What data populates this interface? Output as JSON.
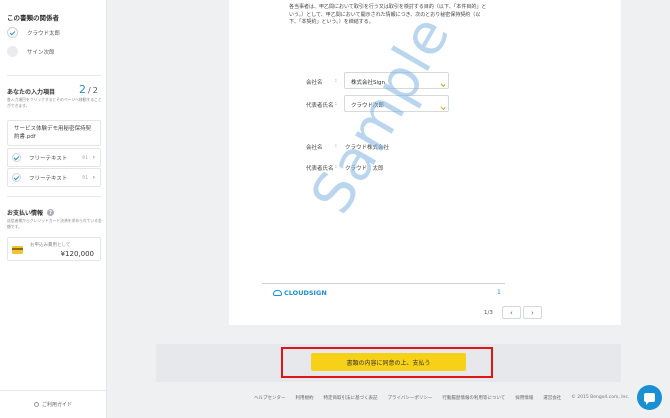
{
  "sidebar": {
    "parties_title": "この書類の関係者",
    "parties": [
      {
        "name": "クラウド太郎",
        "done": true
      },
      {
        "name": "サイン次郎",
        "done": false
      }
    ],
    "inputs_title": "あなたの入力項目",
    "inputs_done": "2",
    "inputs_total": "2",
    "inputs_desc": "各入力項目をクリックするとそのページへ移動することができます。",
    "doc_name": "サービス体験デモ用秘密保持契約書.pdf",
    "fields": [
      {
        "label": "フリーテキスト",
        "page": "P.1"
      },
      {
        "label": "フリーテキスト",
        "page": "P.1"
      }
    ],
    "payment_title": "お支払い情報",
    "payment_desc": "送信者様からクレジットカード決済を求められている金額です。",
    "payment_label": "お申込み費用として",
    "payment_amount": "¥120,000",
    "help_label": "ご利用ガイド"
  },
  "document": {
    "paragraph": "各当事者は、甲乙間において取引を行う又は取引を検討する目的（以下、「本件目的」という。）として、甲乙間において開示された情報につき、次のとおり秘密保持契約（以下、「本契約」という。）を締結する。",
    "party1": {
      "company_label": "会社名",
      "company_value": "株式会社Sign",
      "rep_label": "代表者氏名",
      "rep_value": "クラウド次郎"
    },
    "party2": {
      "company_label": "会社名",
      "company_value": "クラウド株式会社",
      "rep_label": "代表者氏名",
      "rep_value": "クラウド　太郎"
    },
    "colon": ":",
    "watermark": "Sample",
    "logo": "CLOUDSIGN",
    "page_number": "1",
    "pager_count": "1/3",
    "prev_glyph": "‹",
    "next_glyph": "›"
  },
  "action": {
    "agree_label": "書類の内容に同意の上、支払う"
  },
  "footer": {
    "links": [
      "ヘルプセンター",
      "利用規約",
      "特定商取引法に基づく表記",
      "プライバシーポリシー",
      "行動履歴情報の利用等について",
      "採用情報",
      "運営会社"
    ],
    "copyright": "© 2015 Bengo4.com, Inc."
  },
  "colors": {
    "accent": "#1a8fd3",
    "button": "#f7d117",
    "highlight": "#e01515"
  }
}
